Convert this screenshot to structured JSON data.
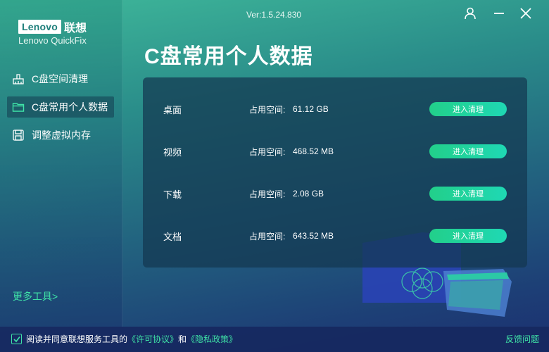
{
  "brand": {
    "logo_text": "Lenovo",
    "logo_cn": "联想",
    "app_name": "Lenovo QuickFix"
  },
  "version": "Ver:1.5.24.830",
  "window": {
    "user_icon": "user-icon",
    "minimize_icon": "minimize-icon",
    "close_icon": "close-icon"
  },
  "sidebar": {
    "items": [
      {
        "label": "C盘空间清理",
        "icon": "broom-icon",
        "active": false
      },
      {
        "label": "C盘常用个人数据",
        "icon": "folder-icon",
        "active": true
      },
      {
        "label": "调整虚拟内存",
        "icon": "memory-icon",
        "active": false
      }
    ],
    "more_tools": "更多工具>"
  },
  "main": {
    "title": "C盘常用个人数据",
    "rows": [
      {
        "name": "桌面",
        "usage_label": "占用空间:",
        "usage_value": "61.12 GB",
        "button": "进入清理"
      },
      {
        "name": "视频",
        "usage_label": "占用空间:",
        "usage_value": "468.52 MB",
        "button": "进入清理"
      },
      {
        "name": "下载",
        "usage_label": "占用空间:",
        "usage_value": "2.08 GB",
        "button": "进入清理"
      },
      {
        "name": "文档",
        "usage_label": "占用空间:",
        "usage_value": "643.52 MB",
        "button": "进入清理"
      }
    ]
  },
  "footer": {
    "agree_prefix": "阅读并同意联想服务工具的",
    "license_link": "《许可协议》",
    "and_text": "和",
    "privacy_link": "《隐私政策》",
    "feedback": "反馈问题",
    "checked": true
  },
  "colors": {
    "accent": "#3fe3a7",
    "button": "#22cf8a",
    "panel": "#14374f"
  }
}
